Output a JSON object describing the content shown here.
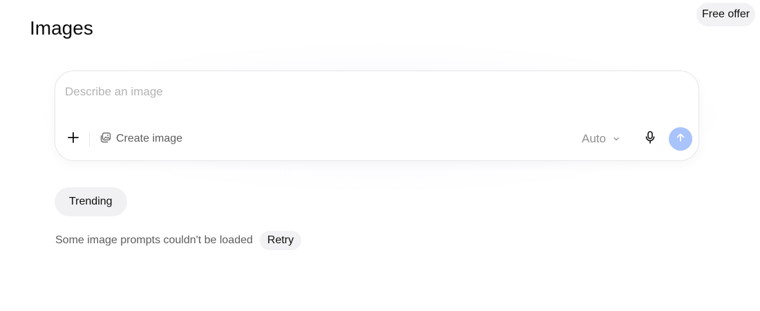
{
  "header": {
    "title": "Images",
    "free_offer_label": "Free offer"
  },
  "composer": {
    "placeholder": "Describe an image",
    "value": "",
    "create_image_label": "Create image",
    "model_select_value": "Auto",
    "icons": {
      "add": "plus-icon",
      "create_image": "image-stack-icon",
      "model_select": "chevron-down-icon",
      "mic": "microphone-icon",
      "send": "arrow-up-icon"
    }
  },
  "trending": {
    "label": "Trending"
  },
  "error": {
    "message": "Some image prompts couldn't be loaded",
    "retry_label": "Retry"
  },
  "colors": {
    "send_button": "#a9c3fb",
    "chip_background": "#f1f1f3",
    "text_primary": "#0d0d0d",
    "text_secondary": "#5d5d5d"
  }
}
